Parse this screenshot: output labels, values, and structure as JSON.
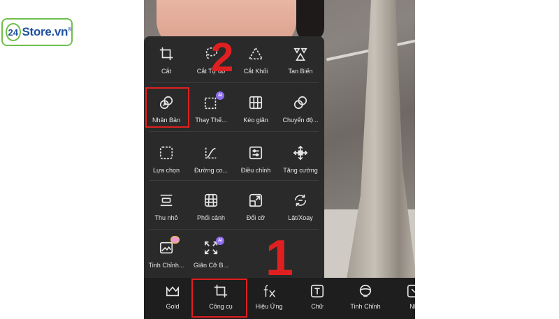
{
  "logo": {
    "badge": "24",
    "name": "Store.vn",
    "mark": "®"
  },
  "tools": [
    {
      "label": "Cắt",
      "icon": "crop-icon"
    },
    {
      "label": "Cắt Tự do",
      "icon": "lasso-icon"
    },
    {
      "label": "Cắt Khối",
      "icon": "triangle-shape-icon"
    },
    {
      "label": "Tan Biến",
      "icon": "shapes-icon"
    },
    {
      "label": "Nhân Bản",
      "icon": "clone-icon"
    },
    {
      "label": "Thay Thế...",
      "icon": "replace-ai-icon"
    },
    {
      "label": "Kéo giãn",
      "icon": "stretch-grid-icon"
    },
    {
      "label": "Chuyển độ...",
      "icon": "motion-icon"
    },
    {
      "label": "Lựa chọn",
      "icon": "selection-icon"
    },
    {
      "label": "Đường co...",
      "icon": "curve-icon"
    },
    {
      "label": "Điều chỉnh",
      "icon": "adjust-icon"
    },
    {
      "label": "Tăng cường",
      "icon": "enhance-icon"
    },
    {
      "label": "Thu nhỏ",
      "icon": "shrink-icon"
    },
    {
      "label": "Phối cảnh",
      "icon": "perspective-icon"
    },
    {
      "label": "Đổi cỡ",
      "icon": "resize-icon"
    },
    {
      "label": "Lật/Xoay",
      "icon": "flip-rotate-icon"
    },
    {
      "label": "Tinh Chỉnh...",
      "icon": "refine-image-icon"
    },
    {
      "label": "Giãn Cỡ B...",
      "icon": "expand-ai-icon"
    }
  ],
  "bottom_bar": [
    {
      "label": "Gold",
      "icon": "crown-icon"
    },
    {
      "label": "Công cụ",
      "icon": "crop-tool-icon"
    },
    {
      "label": "Hiệu Ứng",
      "icon": "fx-icon"
    },
    {
      "label": "Chữ",
      "icon": "text-icon"
    },
    {
      "label": "Tinh Chỉnh",
      "icon": "retouch-icon"
    },
    {
      "label": "Nh",
      "icon": "sticker-icon"
    }
  ],
  "badges": {
    "ai": "AI"
  },
  "annotations": {
    "step_one": "1",
    "step_two": "2"
  },
  "colors": {
    "annotation": "#e02020",
    "panel": "#2a2a2a",
    "bar": "#1e1e1e",
    "ai_badge": "#8e6cf0",
    "logo_green": "#6fbf4b",
    "logo_blue": "#1e4fa0"
  }
}
